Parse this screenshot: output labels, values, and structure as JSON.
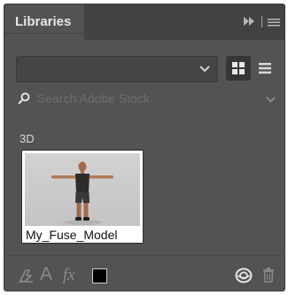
{
  "panel": {
    "tab_label": "Libraries",
    "tab_icons": [
      "fast-forward-icon",
      "panel-menu-icon"
    ]
  },
  "toolbar": {
    "library_dropdown_value": "",
    "view_modes": [
      "grid-view-icon",
      "list-view-icon"
    ],
    "active_view": "grid"
  },
  "search": {
    "placeholder": "Search Adobe Stock"
  },
  "section": {
    "title": "3D",
    "assets": [
      {
        "name": "My_Fuse_Model",
        "thumbnail": "3d-human-model"
      }
    ]
  },
  "footer": {
    "character_style_glyph": "A",
    "fx_glyph": "fx",
    "icons": [
      "add-content-icon",
      "character-style-icon",
      "layer-style-icon",
      "foreground-color-swatch",
      "creative-cloud-sync-icon",
      "trash-icon"
    ],
    "foreground_color": "#000000"
  }
}
